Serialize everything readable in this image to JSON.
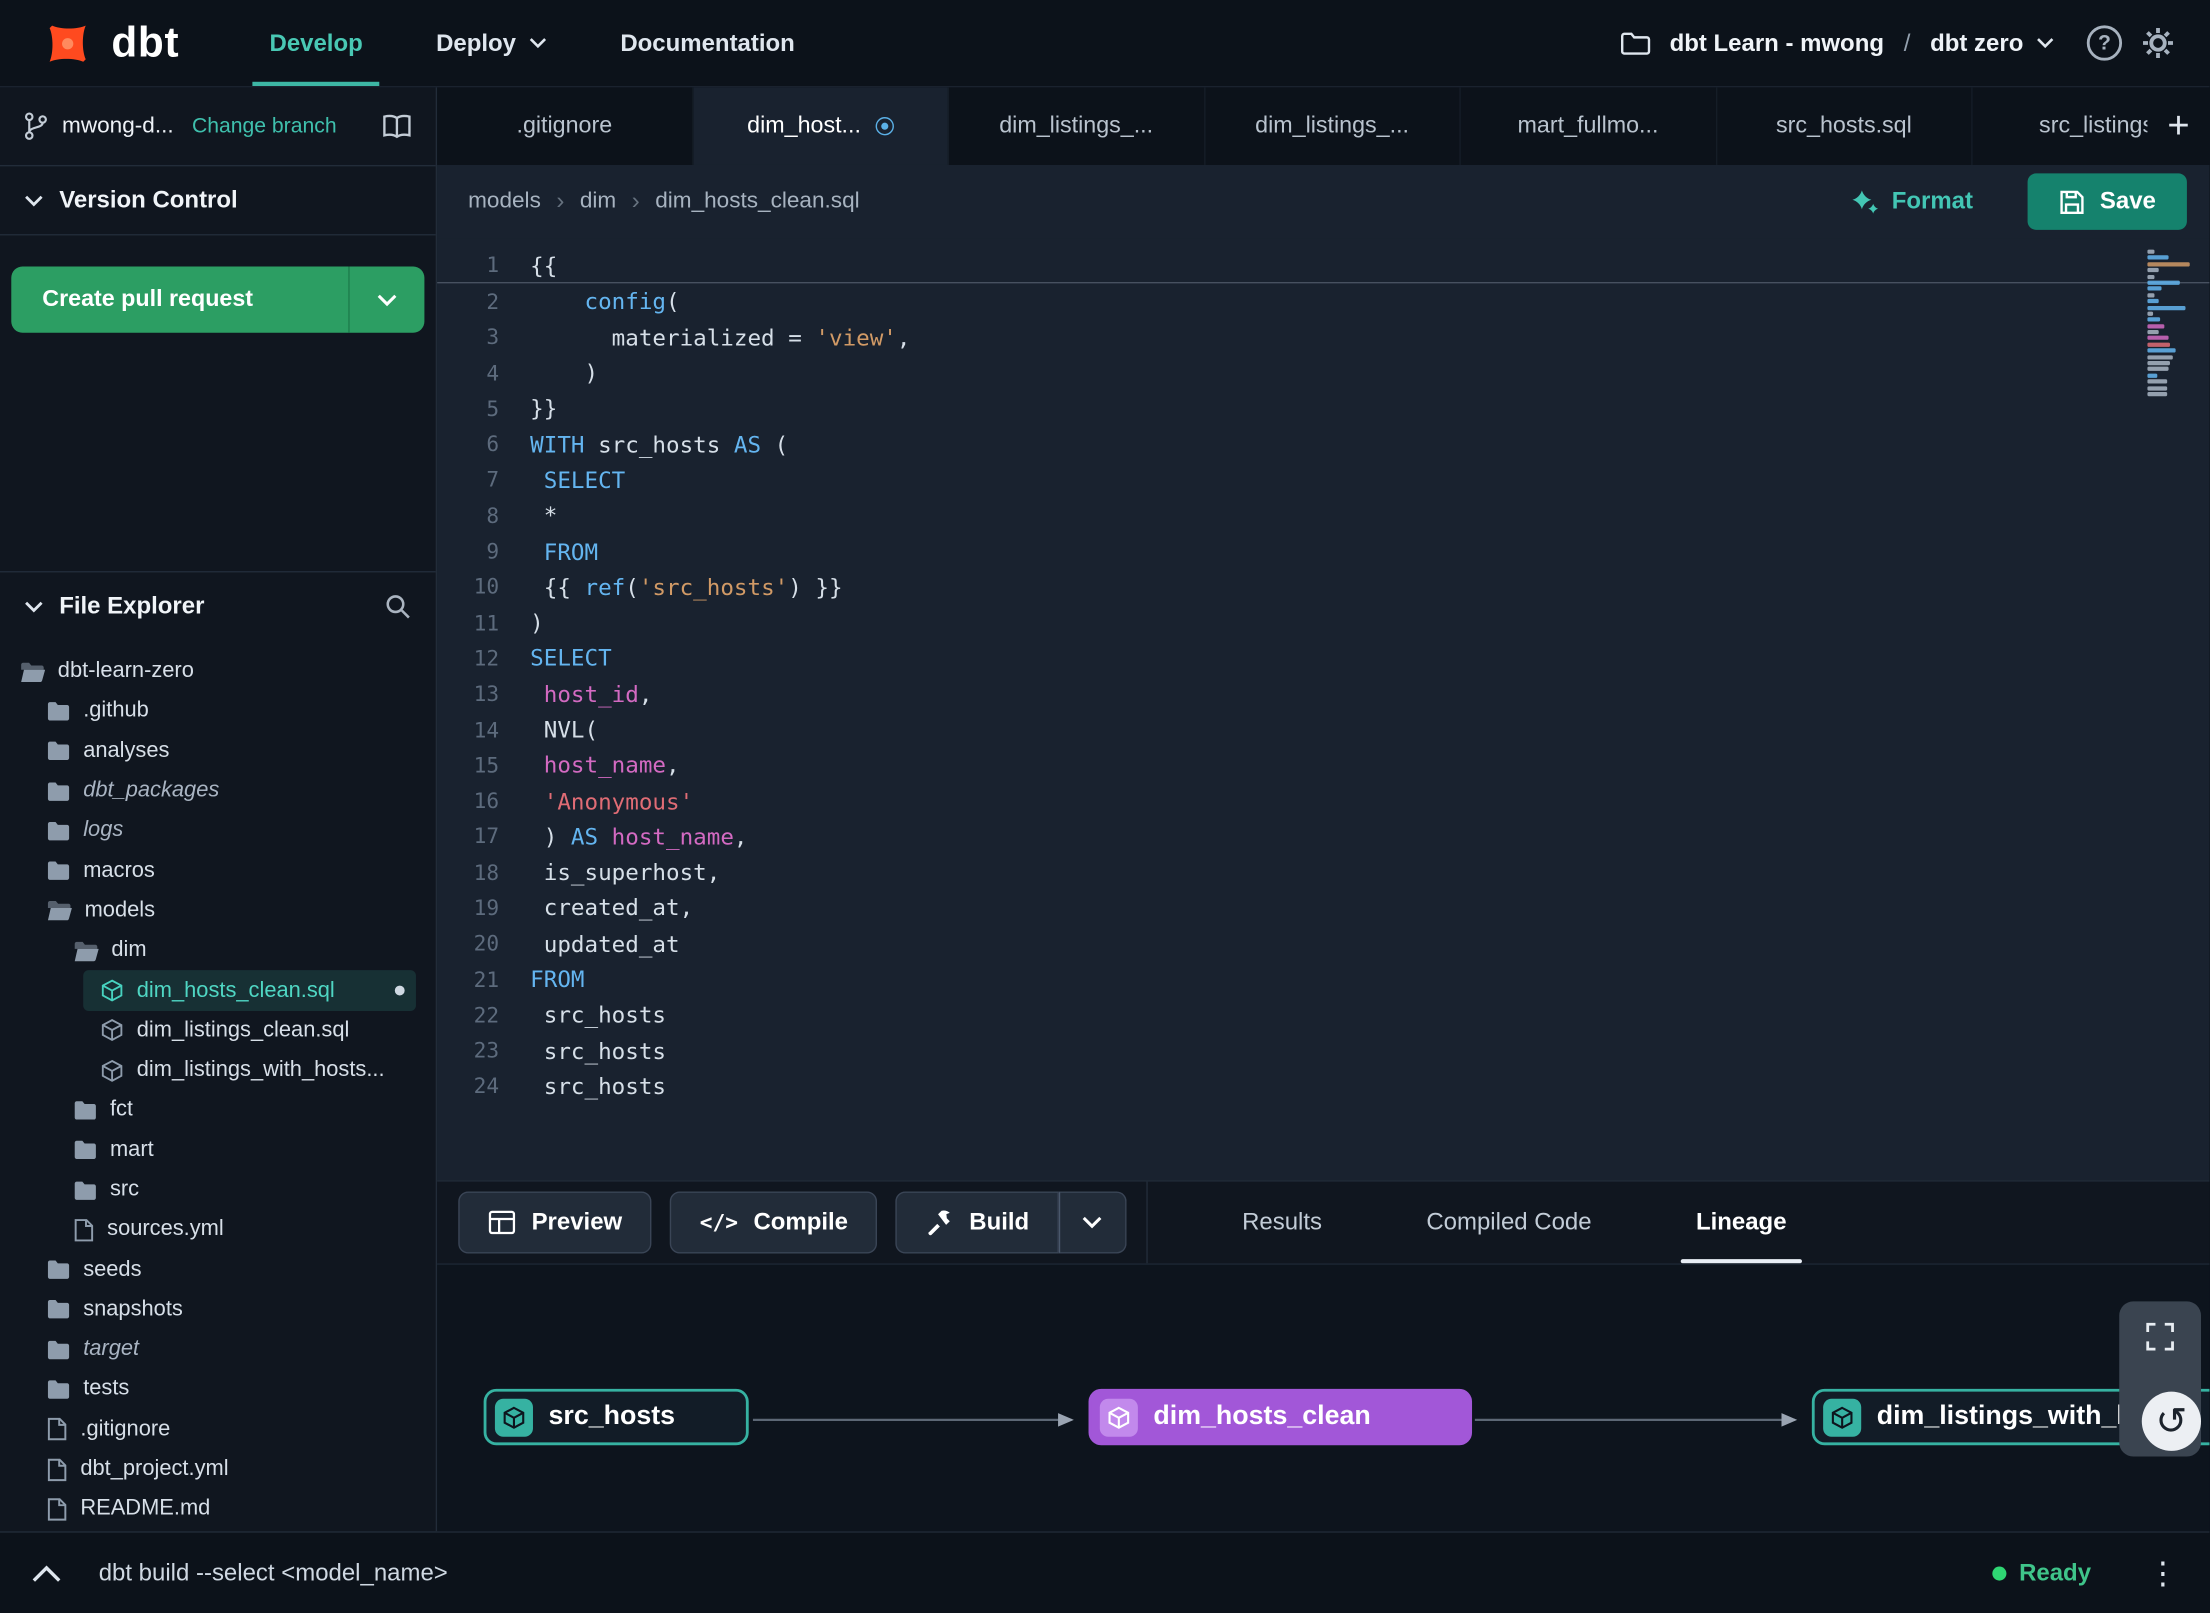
{
  "topbar": {
    "logo_text": "dbt",
    "nav": [
      {
        "label": "Develop",
        "active": true
      },
      {
        "label": "Deploy",
        "dropdown": true
      },
      {
        "label": "Documentation"
      }
    ],
    "project": {
      "account": "dbt Learn - mwong",
      "separator": "/",
      "name": "dbt zero"
    }
  },
  "sidebar": {
    "branch": {
      "name": "mwong-d...",
      "change_label": "Change branch"
    },
    "version_control_label": "Version Control",
    "create_pr_label": "Create pull request",
    "file_explorer_label": "File Explorer",
    "tree": [
      {
        "label": "dbt-learn-zero",
        "type": "folder-open",
        "depth": 0
      },
      {
        "label": ".github",
        "type": "folder",
        "depth": 1
      },
      {
        "label": "analyses",
        "type": "folder",
        "depth": 1
      },
      {
        "label": "dbt_packages",
        "type": "folder",
        "depth": 1,
        "italic": true
      },
      {
        "label": "logs",
        "type": "folder",
        "depth": 1,
        "italic": true
      },
      {
        "label": "macros",
        "type": "folder",
        "depth": 1
      },
      {
        "label": "models",
        "type": "folder-open",
        "depth": 1
      },
      {
        "label": "dim",
        "type": "folder-open",
        "depth": 2
      },
      {
        "label": "dim_hosts_clean.sql",
        "type": "model",
        "depth": 3,
        "selected": true,
        "modified": true
      },
      {
        "label": "dim_listings_clean.sql",
        "type": "model",
        "depth": 3
      },
      {
        "label": "dim_listings_with_hosts...",
        "type": "model",
        "depth": 3
      },
      {
        "label": "fct",
        "type": "folder",
        "depth": 2
      },
      {
        "label": "mart",
        "type": "folder",
        "depth": 2
      },
      {
        "label": "src",
        "type": "folder",
        "depth": 2
      },
      {
        "label": "sources.yml",
        "type": "file",
        "depth": 2
      },
      {
        "label": "seeds",
        "type": "folder",
        "depth": 1
      },
      {
        "label": "snapshots",
        "type": "folder",
        "depth": 1
      },
      {
        "label": "target",
        "type": "folder",
        "depth": 1,
        "italic": true
      },
      {
        "label": "tests",
        "type": "folder",
        "depth": 1
      },
      {
        "label": ".gitignore",
        "type": "file",
        "depth": 1
      },
      {
        "label": "dbt_project.yml",
        "type": "file",
        "depth": 1
      },
      {
        "label": "README.md",
        "type": "file",
        "depth": 1
      }
    ]
  },
  "tabs": [
    {
      "label": ".gitignore"
    },
    {
      "label": "dim_host...",
      "active": true,
      "modified": true
    },
    {
      "label": "dim_listings_..."
    },
    {
      "label": "dim_listings_..."
    },
    {
      "label": "mart_fullmo..."
    },
    {
      "label": "src_hosts.sql"
    },
    {
      "label": "src_listings."
    }
  ],
  "breadcrumb": [
    "models",
    "dim",
    "dim_hosts_clean.sql"
  ],
  "editor_actions": {
    "format_label": "Format",
    "save_label": "Save"
  },
  "editor": {
    "lines": [
      [
        [
          "p",
          "{{"
        ]
      ],
      [
        [
          "p",
          "    "
        ],
        [
          "f",
          "config"
        ],
        [
          "p",
          "("
        ]
      ],
      [
        [
          "p",
          "      materialized = "
        ],
        [
          "s",
          "'view'"
        ],
        [
          "p",
          ","
        ]
      ],
      [
        [
          "p",
          "    )"
        ]
      ],
      [
        [
          "p",
          "}}"
        ]
      ],
      [
        [
          "k",
          "WITH"
        ],
        [
          "p",
          " src_hosts "
        ],
        [
          "k",
          "AS"
        ],
        [
          "p",
          " ("
        ]
      ],
      [
        [
          "p",
          " "
        ],
        [
          "k",
          "SELECT"
        ]
      ],
      [
        [
          "p",
          " *"
        ]
      ],
      [
        [
          "p",
          " "
        ],
        [
          "k",
          "FROM"
        ]
      ],
      [
        [
          "p",
          " {{ "
        ],
        [
          "f",
          "ref"
        ],
        [
          "p",
          "("
        ],
        [
          "s",
          "'src_hosts'"
        ],
        [
          "p",
          ") }}"
        ]
      ],
      [
        [
          "p",
          ")"
        ]
      ],
      [
        [
          "k",
          "SELECT"
        ]
      ],
      [
        [
          "p",
          " "
        ],
        [
          "v",
          "host_id"
        ],
        [
          "p",
          ","
        ]
      ],
      [
        [
          "p",
          " NVL("
        ]
      ],
      [
        [
          "p",
          " "
        ],
        [
          "v",
          "host_name"
        ],
        [
          "p",
          ","
        ]
      ],
      [
        [
          "p",
          " "
        ],
        [
          "s2",
          "'Anonymous'"
        ]
      ],
      [
        [
          "p",
          " ) "
        ],
        [
          "k",
          "AS"
        ],
        [
          "p",
          " "
        ],
        [
          "v",
          "host_name"
        ],
        [
          "p",
          ","
        ]
      ],
      [
        [
          "p",
          " is_superhost,"
        ]
      ],
      [
        [
          "p",
          " created_at,"
        ]
      ],
      [
        [
          "p",
          " updated_at"
        ]
      ],
      [
        [
          "k",
          "FROM"
        ]
      ],
      [
        [
          "p",
          " src_hosts"
        ]
      ],
      [
        [
          "p",
          " src_hosts"
        ]
      ],
      [
        [
          "p",
          " src_hosts"
        ]
      ]
    ]
  },
  "bottom_toolbar": {
    "preview_label": "Preview",
    "compile_label": "Compile",
    "build_label": "Build",
    "tabs": [
      {
        "label": "Results"
      },
      {
        "label": "Compiled Code"
      },
      {
        "label": "Lineage",
        "active": true
      }
    ]
  },
  "lineage": {
    "nodes": [
      {
        "label": "src_hosts",
        "style": "teal"
      },
      {
        "label": "dim_hosts_clean",
        "style": "purple"
      },
      {
        "label": "dim_listings_with_hosts",
        "style": "teal",
        "clipped": true
      }
    ]
  },
  "statusbar": {
    "command": "dbt build --select <model_name>",
    "status_label": "Ready"
  },
  "icons": {
    "help_glyph": "?",
    "compile_glyph": "</>",
    "undo_glyph": "↺",
    "ellipsis_glyph": "⋮",
    "plus_glyph": "+",
    "crumb_separator": "›"
  },
  "colors": {
    "accent_teal": "#3db6a4",
    "brand_orange": "#ff4a1f",
    "node_purple": "#a257d8",
    "pr_green": "#2c9e63",
    "save_teal": "#15826d",
    "ready_green": "#2fd673"
  }
}
